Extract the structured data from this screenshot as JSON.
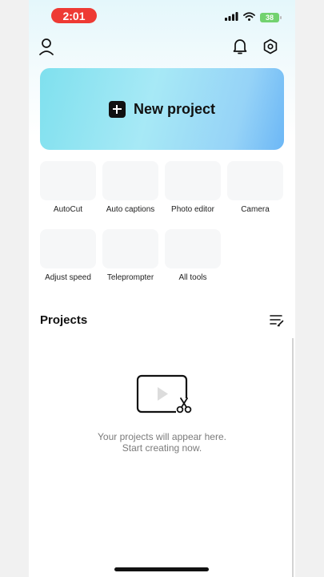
{
  "status_bar": {
    "time": "2:01",
    "battery": "38"
  },
  "main": {
    "new_project_label": "New project",
    "tools": [
      {
        "label": "AutoCut"
      },
      {
        "label": "Auto captions"
      },
      {
        "label": "Photo editor"
      },
      {
        "label": "Camera"
      },
      {
        "label": "Adjust speed"
      },
      {
        "label": "Teleprompter"
      },
      {
        "label": "All tools"
      }
    ]
  },
  "projects": {
    "title": "Projects",
    "empty_line1": "Your projects will appear here.",
    "empty_line2": "Start creating now."
  },
  "colors": {
    "time_pill": "#ee3a34",
    "battery": "#72d26f",
    "gradient_start": "#7fe0ee",
    "gradient_end": "#6cb7f6"
  }
}
